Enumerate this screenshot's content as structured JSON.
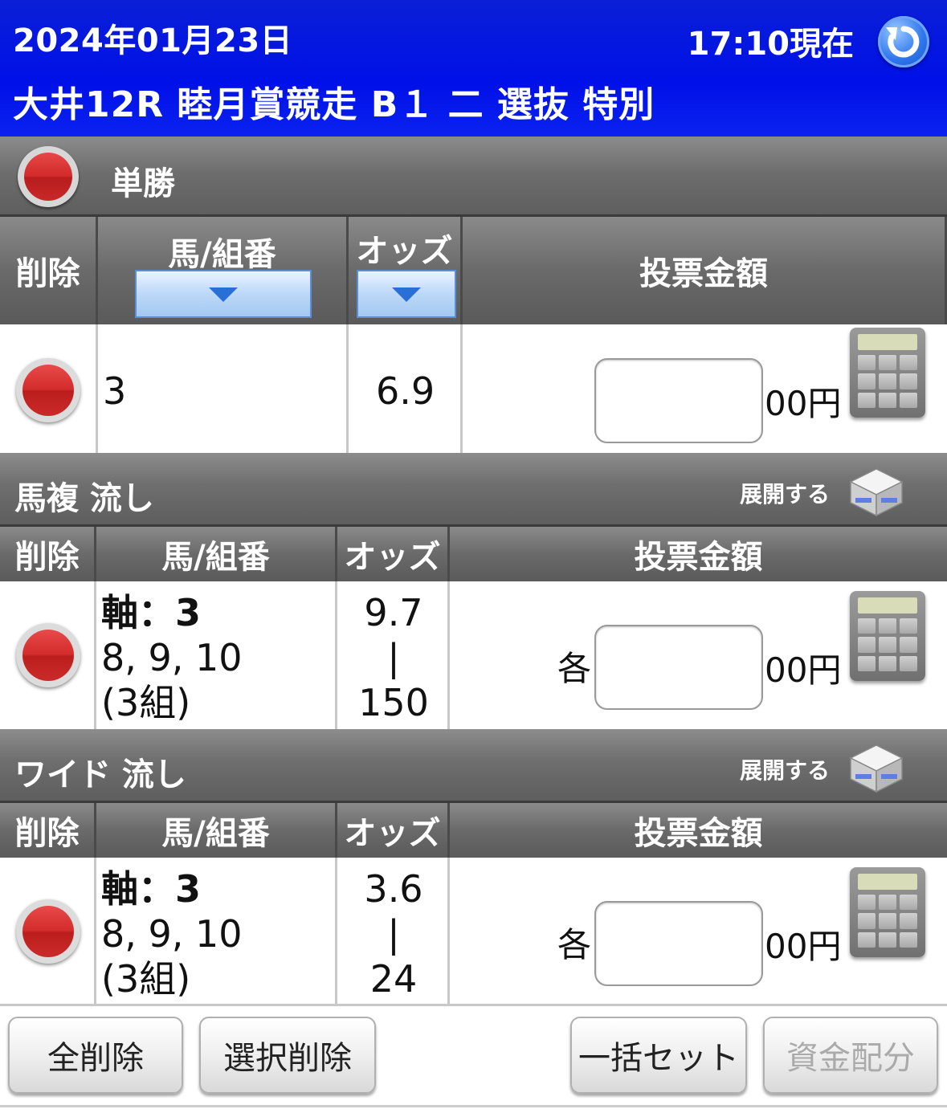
{
  "header": {
    "date": "2024年01月23日",
    "time_now": "17:10現在",
    "race_title": "大井12R 睦月賞競走 B１ 二 選抜 特別"
  },
  "icons": {
    "refresh": "refresh-icon",
    "delete": "delete-ball-icon",
    "calculator": "calculator-icon",
    "expand": "expand-cube-icon"
  },
  "colors": {
    "header_blue": "#0010e8",
    "section_gray": "#6e6e6e",
    "delete_red": "#d12a2a"
  },
  "columns": {
    "delete": "削除",
    "horse": "馬/組番",
    "odds": "オッズ",
    "amount": "投票金額"
  },
  "sections": [
    {
      "title": "単勝",
      "row": {
        "horse": "3",
        "odds": "6.9",
        "unit": "00円"
      }
    },
    {
      "title": "馬複 流し",
      "expand_label": "展開する",
      "row": {
        "axis": "軸：3",
        "partners": "8, 9, 10",
        "combos": "(3組)",
        "odds_low": "9.7",
        "odds_sep": "|",
        "odds_high": "150",
        "each": "各",
        "unit": "00円"
      }
    },
    {
      "title": "ワイド 流し",
      "expand_label": "展開する",
      "row": {
        "axis": "軸：3",
        "partners": "8, 9, 10",
        "combos": "(3組)",
        "odds_low": "3.6",
        "odds_sep": "|",
        "odds_high": "24",
        "each": "各",
        "unit": "00円"
      }
    }
  ],
  "buttons": {
    "delete_all": "全削除",
    "delete_selected": "選択削除",
    "bulk_set": "一括セット",
    "fund_allocation": "資金配分"
  }
}
